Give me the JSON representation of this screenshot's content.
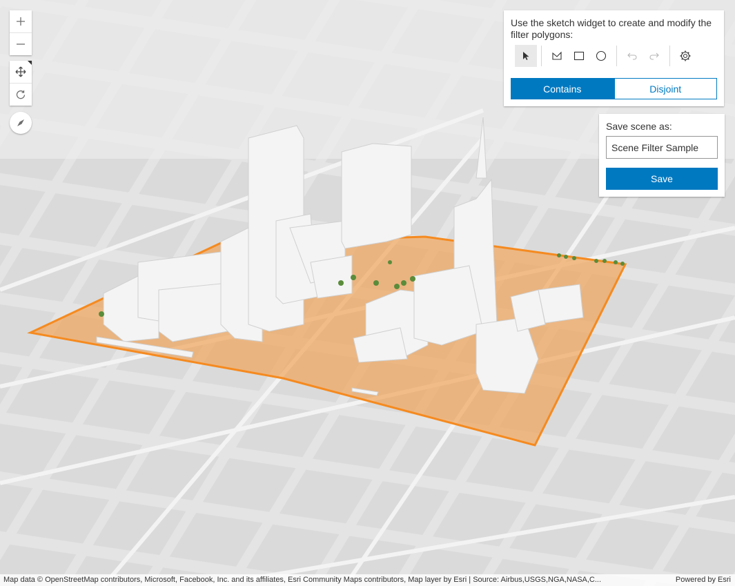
{
  "navigation": {
    "zoom_in": "plus-icon",
    "zoom_out": "minus-icon",
    "pan": "pan-icon",
    "rotate": "rotate-icon",
    "compass": "compass-icon"
  },
  "sketch_panel": {
    "instruction": "Use the sketch widget to create and modify the filter polygons:",
    "tools": [
      "select-icon",
      "polygon-icon",
      "rectangle-icon",
      "circle-icon",
      "undo-icon",
      "redo-icon",
      "settings-icon"
    ],
    "spatial_relationship": {
      "options": [
        "Contains",
        "Disjoint"
      ],
      "selected": "Contains"
    }
  },
  "save_panel": {
    "label": "Save scene as:",
    "input_value": "Scene Filter Sample",
    "save_label": "Save"
  },
  "colors": {
    "accent": "#0079c1",
    "filter_polygon_fill": "#f0a45a",
    "filter_polygon_outline": "#f58a1f",
    "buildings": "#f4f4f4",
    "basemap": "#e6e6e6"
  },
  "attribution": {
    "text": "Map data © OpenStreetMap contributors, Microsoft, Facebook, Inc. and its affiliates, Esri Community Maps contributors, Map layer by Esri | Source: Airbus,USGS,NGA,NASA,C...",
    "powered_by": "Powered by Esri"
  }
}
